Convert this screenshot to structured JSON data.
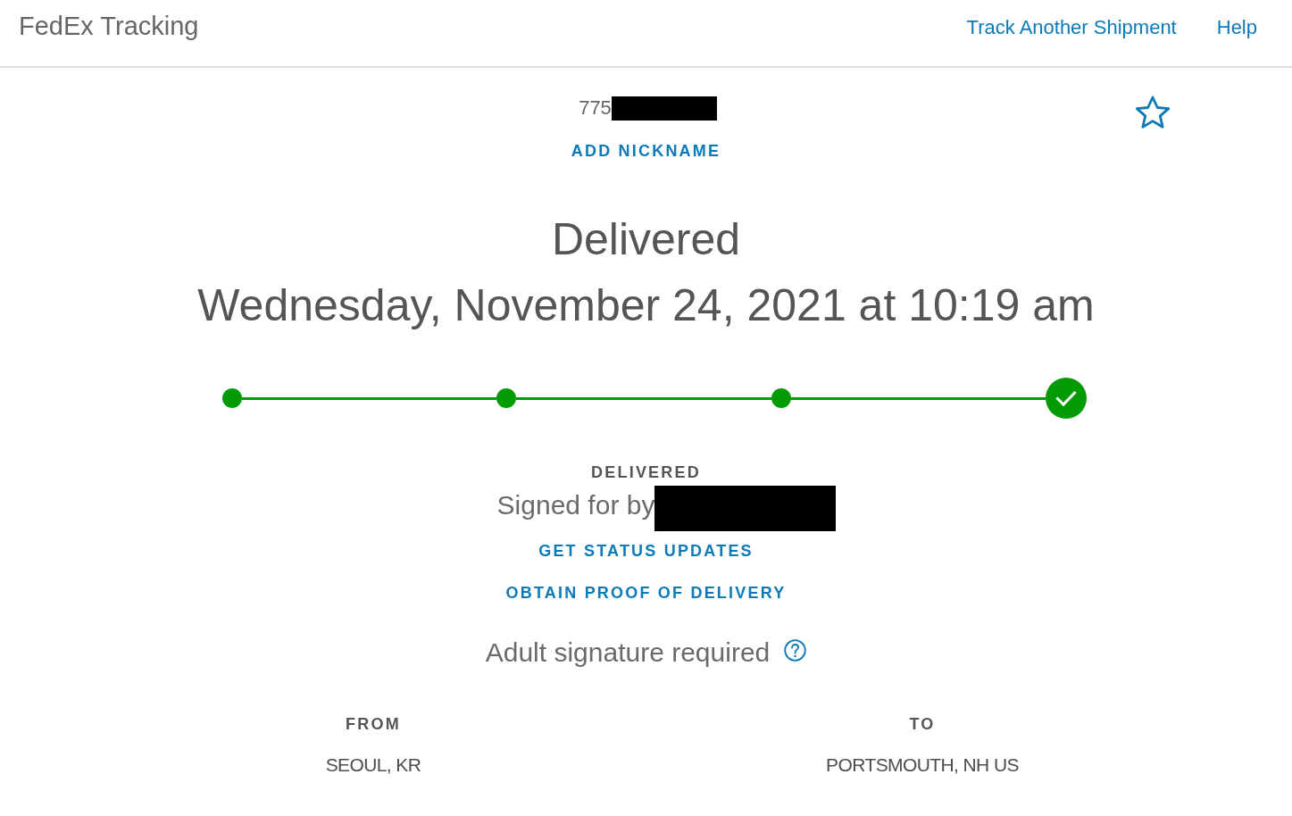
{
  "header": {
    "title": "FedEx Tracking",
    "links": [
      "Track Another Shipment",
      "Help"
    ]
  },
  "shipment": {
    "tracking_number": "775",
    "tracking_redacted": true,
    "favorite": false,
    "add_nickname": "ADD NICKNAME"
  },
  "status": {
    "heading": "Delivered",
    "date": "Wednesday, November 24, 2021 at 10:19 am"
  },
  "progress": {
    "steps": [
      {
        "kind": "dot",
        "completed": true
      },
      {
        "kind": "dot",
        "completed": true
      },
      {
        "kind": "dot",
        "completed": true
      },
      {
        "kind": "check",
        "completed": true
      }
    ]
  },
  "delivery": {
    "label": "DELIVERED",
    "signed_for": "Signed for by",
    "signer_redacted": true,
    "actions": [
      "GET STATUS UPDATES",
      "OBTAIN PROOF OF DELIVERY"
    ],
    "signature_note": "Adult signature required"
  },
  "route": [
    {
      "label": "FROM",
      "place": "SEOUL, KR"
    },
    {
      "label": "TO",
      "place": "PORTSMOUTH, NH US"
    }
  ]
}
